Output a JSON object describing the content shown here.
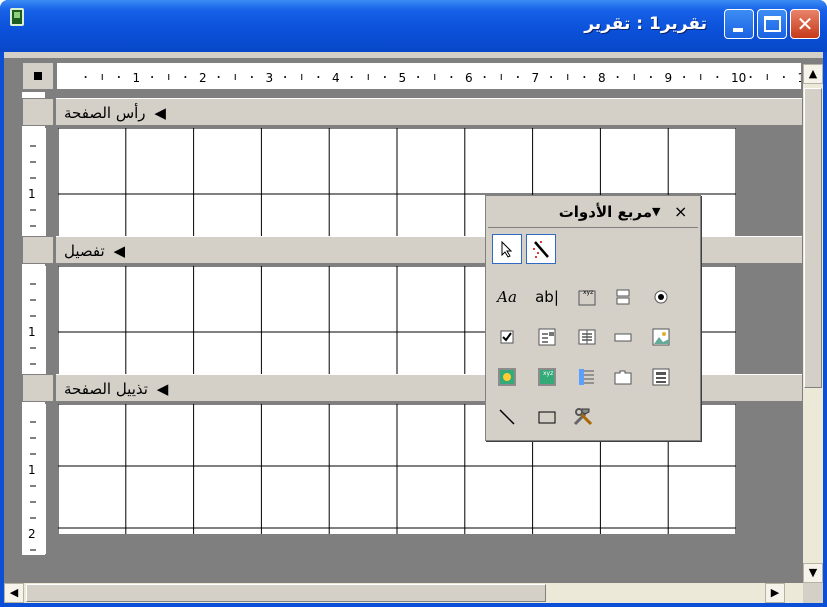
{
  "window": {
    "title": "تقرير1 : تقرير",
    "close_glyph": "✕",
    "minimize_label": "",
    "maximize_label": ""
  },
  "ruler": {
    "numbers": [
      "1",
      "2",
      "3",
      "4",
      "5",
      "6",
      "7",
      "8",
      "9",
      "10",
      "1"
    ]
  },
  "vruler": {
    "header_numbers": [
      "1"
    ],
    "detail_numbers": [
      "1"
    ],
    "footer_numbers": [
      "1",
      "2"
    ]
  },
  "sections": {
    "page_header": "رأس الصفحة",
    "detail": "تفصيل",
    "page_footer": "تذييل الصفحة"
  },
  "toolbox": {
    "title": "مربع الأدوات",
    "close_glyph": "×",
    "menu_glyph": "▼",
    "label_tool": "Aa",
    "textbox_tool": "ab|"
  },
  "scroll": {
    "up": "▲",
    "down": "▼",
    "left": "◀",
    "right": "▶"
  },
  "colors": {
    "titlebar": "#0a50d8",
    "section_bar": "#d4d0c8",
    "grid_line": "#000000",
    "background": "#7f7f7f"
  }
}
